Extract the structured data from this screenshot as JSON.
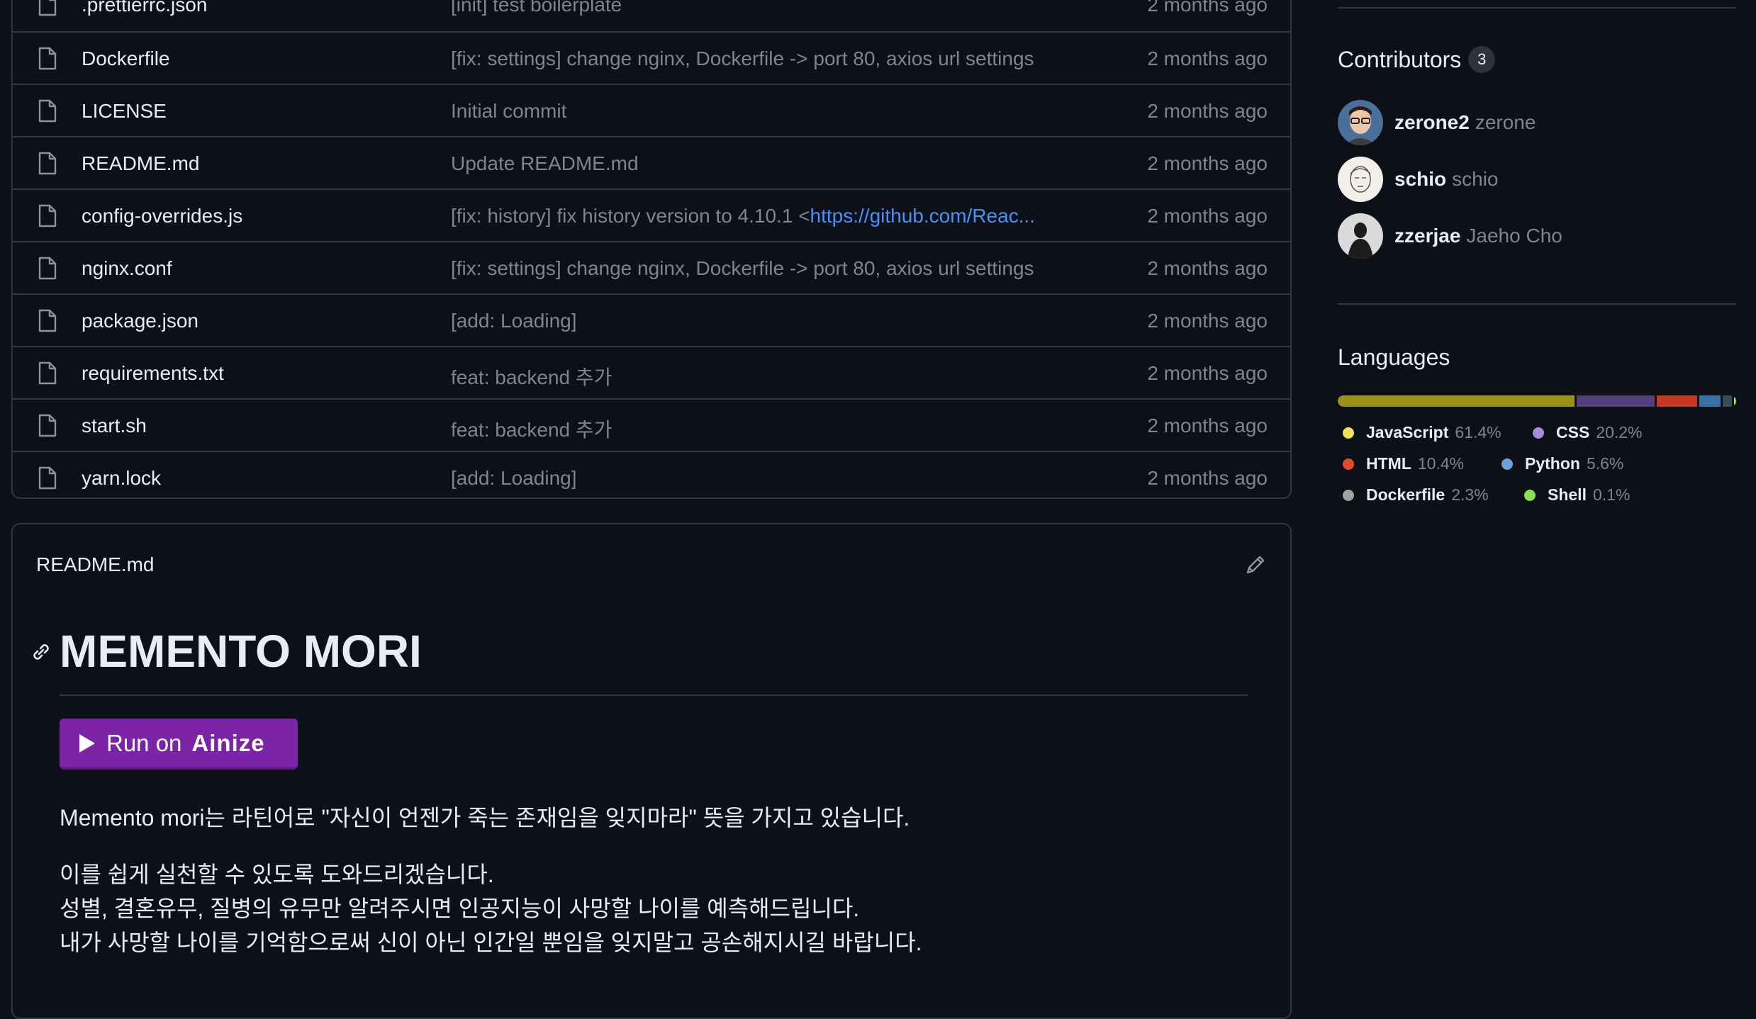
{
  "files": [
    {
      "name": ".prettierrc.json",
      "message": "[init] test boilerplate",
      "age": "2 months ago"
    },
    {
      "name": "Dockerfile",
      "message": "[fix: settings] change nginx, Dockerfile -> port 80, axios url settings",
      "age": "2 months ago"
    },
    {
      "name": "LICENSE",
      "message": "Initial commit",
      "age": "2 months ago"
    },
    {
      "name": "README.md",
      "message": "Update README.md",
      "age": "2 months ago"
    },
    {
      "name": "config-overrides.js",
      "message": "[fix: history] fix history version to 4.10.1 <",
      "message_link": "https://github.com/Reac...",
      "age": "2 months ago"
    },
    {
      "name": "nginx.conf",
      "message": "[fix: settings] change nginx, Dockerfile -> port 80, axios url settings",
      "age": "2 months ago"
    },
    {
      "name": "package.json",
      "message": "[add: Loading]",
      "age": "2 months ago"
    },
    {
      "name": "requirements.txt",
      "message": "feat: backend 추가",
      "age": "2 months ago"
    },
    {
      "name": "start.sh",
      "message": "feat: backend 추가",
      "age": "2 months ago"
    },
    {
      "name": "yarn.lock",
      "message": "[add: Loading]",
      "age": "2 months ago"
    }
  ],
  "readme": {
    "filename": "README.md",
    "heading": "MEMENTO MORI",
    "run_button": {
      "prefix": "Run on",
      "brand": "Ainize"
    },
    "paragraph1": "Memento mori는 라틴어로 \"자신이 언젠가 죽는 존재임을 잊지마라\" 뜻을 가지고 있습니다.",
    "paragraph2_lines": [
      "이를 쉽게 실천할 수 있도록 도와드리겠습니다.",
      "성별, 결혼유무, 질병의 유무만 알려주시면 인공지능이 사망할 나이를 예측해드립니다.",
      "내가 사망할 나이를 기억함으로써 신이 아닌 인간일 뿐임을 잊지말고 공손해지시길 바랍니다."
    ]
  },
  "sidebar": {
    "contributors": {
      "title": "Contributors",
      "count": "3",
      "people": [
        {
          "login": "zerone2",
          "name": "zerone"
        },
        {
          "login": "schio",
          "name": "schio"
        },
        {
          "login": "zzerjae",
          "name": "Jaeho Cho"
        }
      ]
    },
    "languages": {
      "title": "Languages",
      "items": [
        {
          "name": "JavaScript",
          "percent": "61.4%",
          "value": 61.4,
          "color": "#f1e05a",
          "bar_color": "#9a9212"
        },
        {
          "name": "CSS",
          "percent": "20.2%",
          "value": 20.2,
          "color": "#a78bd8",
          "bar_color": "#563d7c"
        },
        {
          "name": "HTML",
          "percent": "10.4%",
          "value": 10.4,
          "color": "#e34c26",
          "bar_color": "#c5381f"
        },
        {
          "name": "Python",
          "percent": "5.6%",
          "value": 5.6,
          "color": "#6ca0d8",
          "bar_color": "#3572a5"
        },
        {
          "name": "Dockerfile",
          "percent": "2.3%",
          "value": 2.3,
          "color": "#a0a0a0",
          "bar_color": "#384d54"
        },
        {
          "name": "Shell",
          "percent": "0.1%",
          "value": 0.1,
          "color": "#89e051",
          "bar_color": "#89e051"
        }
      ]
    }
  },
  "icons": {
    "file": "file-icon",
    "edit": "pencil-icon",
    "anchor": "link-icon",
    "play": "play-icon"
  }
}
